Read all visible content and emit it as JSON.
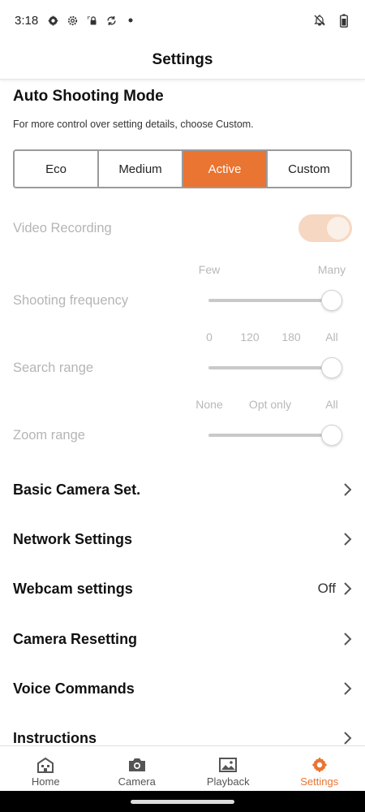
{
  "status_bar": {
    "time": "3:18",
    "left_icons": [
      "settings-gear-icon",
      "settings-gear-outline-icon",
      "sim-lock-icon",
      "sync-icon",
      "dot-icon"
    ],
    "right_icons": [
      "notifications-off-icon",
      "battery-icon"
    ]
  },
  "header": {
    "title": "Settings"
  },
  "auto_shooting": {
    "title": "Auto Shooting Mode",
    "description": "For more control over setting details, choose Custom.",
    "modes": [
      "Eco",
      "Medium",
      "Active",
      "Custom"
    ],
    "selected_mode": "Active"
  },
  "video_recording": {
    "label": "Video Recording",
    "enabled": true,
    "disabled": true
  },
  "shooting_frequency": {
    "label": "Shooting frequency",
    "ticks": [
      "Few",
      "Many"
    ],
    "value_fraction": 1.0
  },
  "search_range": {
    "label": "Search range",
    "ticks": [
      "0",
      "120",
      "180",
      "All"
    ],
    "value_fraction": 1.0
  },
  "zoom_range": {
    "label": "Zoom range",
    "ticks": [
      "None",
      "Opt only",
      "All"
    ],
    "value_fraction": 1.0
  },
  "menu": {
    "items": [
      {
        "label": "Basic Camera Set.",
        "value": ""
      },
      {
        "label": "Network Settings",
        "value": ""
      },
      {
        "label": "Webcam settings",
        "value": "Off"
      },
      {
        "label": "Camera Resetting",
        "value": ""
      },
      {
        "label": "Voice Commands",
        "value": ""
      },
      {
        "label": "Instructions",
        "value": ""
      }
    ]
  },
  "bottom_nav": {
    "items": [
      {
        "label": "Home",
        "icon": "home-icon"
      },
      {
        "label": "Camera",
        "icon": "camera-icon"
      },
      {
        "label": "Playback",
        "icon": "image-icon"
      },
      {
        "label": "Settings",
        "icon": "gear-icon"
      }
    ],
    "active": "Settings"
  },
  "colors": {
    "accent": "#ea7431",
    "toggle_track": "#f6d7c2",
    "disabled_text": "#b5b5b5"
  }
}
